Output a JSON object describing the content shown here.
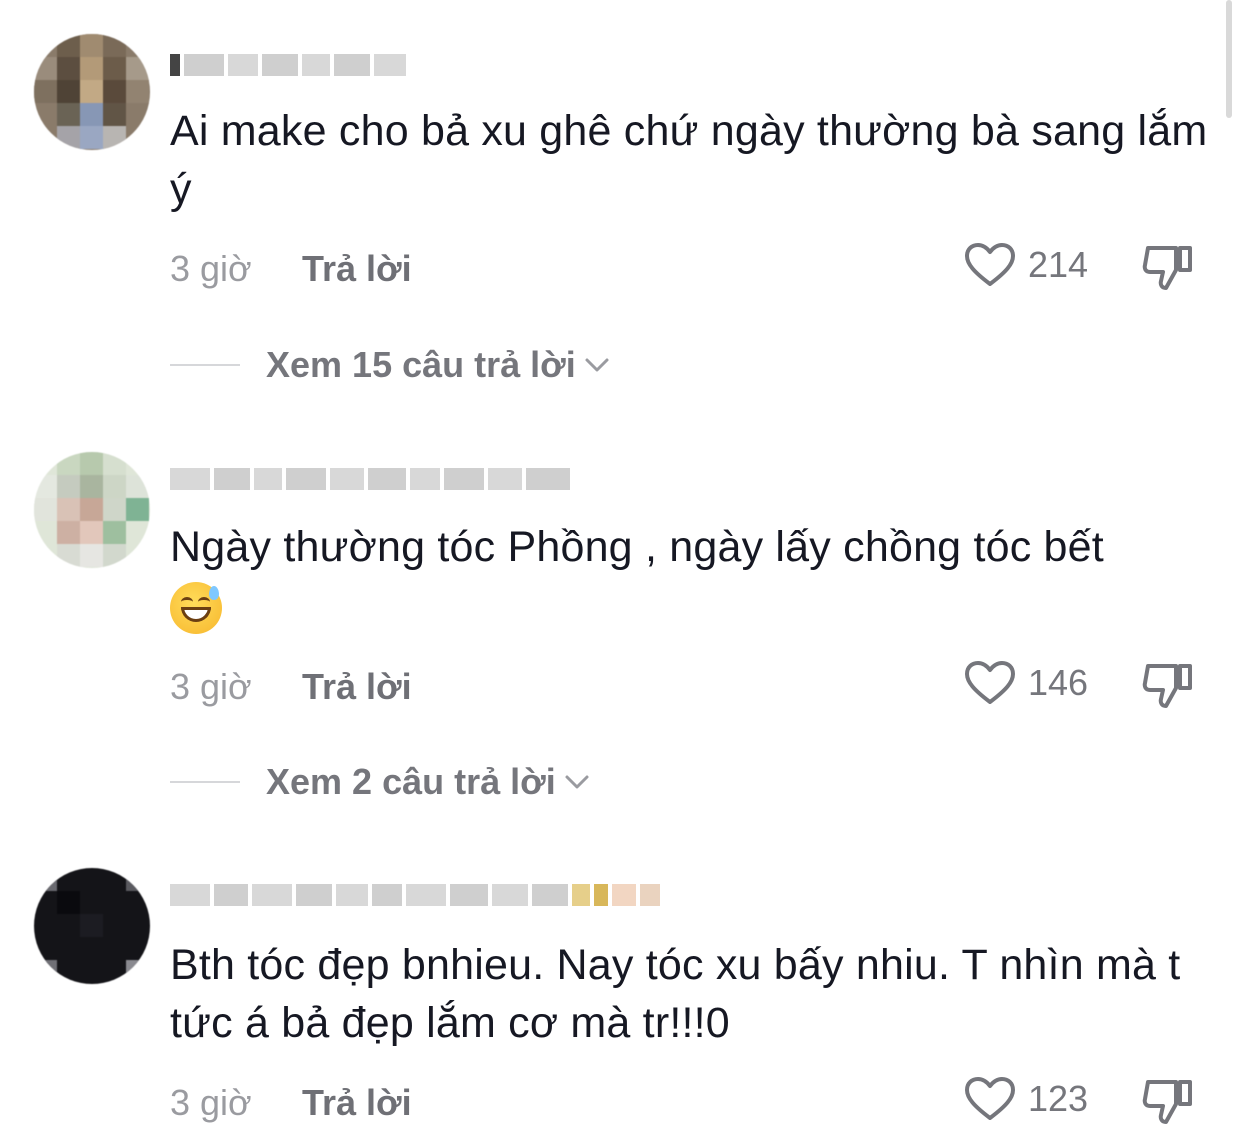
{
  "comments": [
    {
      "text": "Ai make cho bả xu ghê chứ ngày thường bà sang lắm ý",
      "time": "3 giờ",
      "reply_label": "Trả lời",
      "likes": "214",
      "view_replies": "Xem 15 câu trả lời"
    },
    {
      "text": "Ngày thường tóc Phồng , ngày lấy chồng tóc bết",
      "emoji": "grinning-face-with-sweat",
      "time": "3 giờ",
      "reply_label": "Trả lời",
      "likes": "146",
      "view_replies": "Xem 2 câu trả lời"
    },
    {
      "text": "Bth tóc đẹp bnhieu. Nay tóc xu bấy nhiu. T nhìn mà t tức á bả đẹp lắm cơ mà tr!!!0",
      "time": "3 giờ",
      "reply_label": "Trả lời",
      "likes": "123"
    }
  ],
  "colors": {
    "text": "#161823",
    "secondary": "#9a9ba0",
    "icon": "#75767c"
  },
  "icons": {
    "like": "heart-outline-icon",
    "dislike": "thumbs-down-icon",
    "expand": "chevron-down-icon"
  }
}
